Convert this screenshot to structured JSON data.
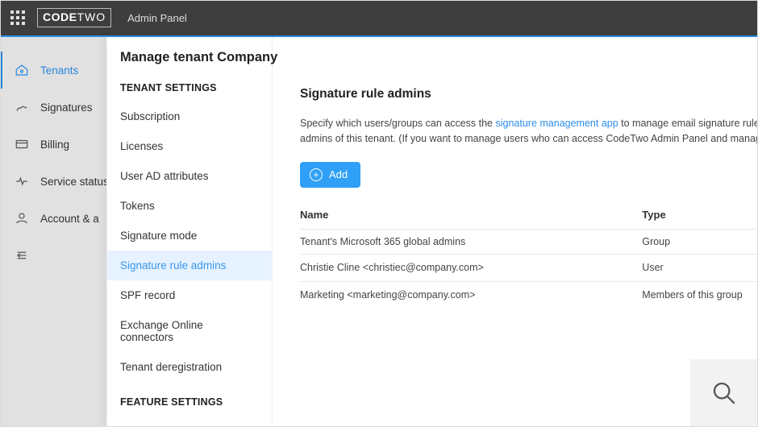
{
  "header": {
    "logo_pre": "CODE",
    "logo_post": "TWO",
    "panel_label": "Admin Panel"
  },
  "leftnav": {
    "items": [
      {
        "id": "tenants",
        "label": "Tenants",
        "active": true
      },
      {
        "id": "signatures",
        "label": "Signatures",
        "active": false
      },
      {
        "id": "billing",
        "label": "Billing",
        "active": false
      },
      {
        "id": "service-status",
        "label": "Service status",
        "active": false
      },
      {
        "id": "account",
        "label": "Account & a",
        "active": false
      }
    ]
  },
  "page": {
    "title": "Manage tenant Company"
  },
  "tenant_settings": {
    "heading1": "TENANT SETTINGS",
    "items1": [
      "Subscription",
      "Licenses",
      "User AD attributes",
      "Tokens",
      "Signature mode",
      "Signature rule admins",
      "SPF record",
      "Exchange Online connectors",
      "Tenant deregistration"
    ],
    "active_index": 5,
    "heading2": "FEATURE SETTINGS"
  },
  "content": {
    "heading": "Signature rule admins",
    "desc_pre": "Specify which users/groups can access the ",
    "desc_link": "signature management app",
    "desc_post": " to manage email signature rules for tenant Com",
    "desc_line2": "admins of this tenant. (If you want to manage users who can access CodeTwo Admin Panel and manage tenants & sub",
    "add_label": "Add",
    "table": {
      "col_name": "Name",
      "col_type": "Type",
      "rows": [
        {
          "name": "Tenant's Microsoft 365 global admins",
          "type": "Group",
          "deletable": false
        },
        {
          "name": "Christie Cline <christiec@company.com>",
          "type": "User",
          "deletable": true
        },
        {
          "name": "Marketing <marketing@company.com>",
          "type": "Members of this group",
          "deletable": true
        }
      ]
    }
  }
}
